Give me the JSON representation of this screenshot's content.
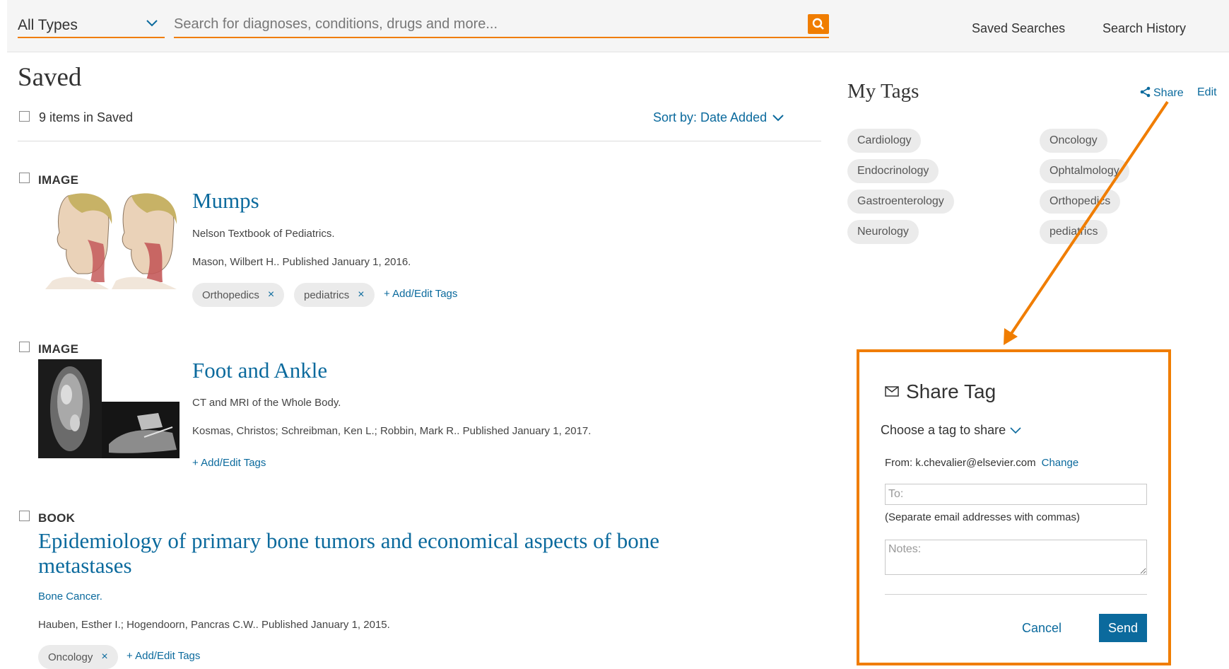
{
  "header": {
    "type_select": "All Types",
    "search_placeholder": "Search for diagnoses, conditions, drugs and more...",
    "saved_searches": "Saved Searches",
    "search_history": "Search History"
  },
  "page": {
    "title": "Saved",
    "items_count": "9 items in Saved",
    "sort": "Sort by: Date Added"
  },
  "results": [
    {
      "type": "IMAGE",
      "title": "Mumps",
      "source": "Nelson Textbook of Pediatrics.",
      "authors": "Mason, Wilbert H.. Published January 1, 2016.",
      "tags": [
        "Orthopedics",
        "pediatrics"
      ],
      "add_tags": "+ Add/Edit Tags"
    },
    {
      "type": "IMAGE",
      "title": "Foot and Ankle",
      "source": "CT and MRI of the Whole Body.",
      "authors": "Kosmas, Christos; Schreibman, Ken L.; Robbin, Mark R.. Published January 1, 2017.",
      "add_tags": "+ Add/Edit Tags"
    },
    {
      "type": "BOOK",
      "title": "Epidemiology of primary bone tumors and economical aspects of bone metastases",
      "source": "Bone Cancer.",
      "authors": "Hauben, Esther I.; Hogendoorn, Pancras C.W.. Published January 1, 2015.",
      "tags": [
        "Oncology"
      ],
      "add_tags": "+ Add/Edit Tags"
    }
  ],
  "my_tags": {
    "title": "My Tags",
    "share": "Share",
    "edit": "Edit",
    "tags": [
      "Cardiology",
      "Endocrinology",
      "Gastroenterology",
      "Neurology",
      "Oncology",
      "Ophtalmology",
      "Orthopedics",
      "pediatrics"
    ]
  },
  "share_panel": {
    "title": "Share Tag",
    "choose": "Choose a tag to share",
    "from_label": "From: k.chevalier@elsevier.com",
    "change": "Change",
    "to_placeholder": "To:",
    "to_hint": "(Separate email addresses with commas)",
    "notes_placeholder": "Notes:",
    "cancel": "Cancel",
    "send": "Send"
  },
  "colors": {
    "accent": "#f07d00",
    "link": "#0b6a9d"
  }
}
